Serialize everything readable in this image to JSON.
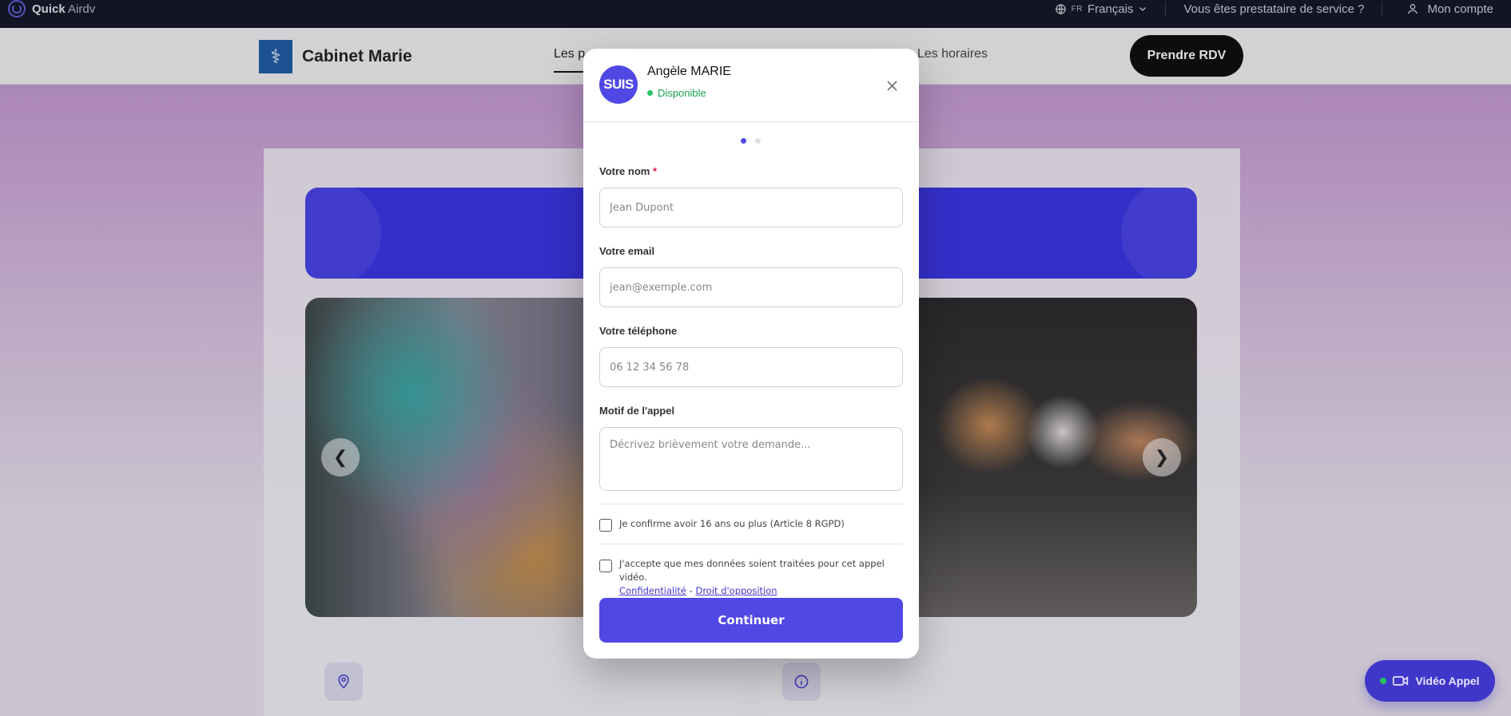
{
  "topbar": {
    "brand_bold": "Quick",
    "brand_rest": "Airdv",
    "lang_code": "FR",
    "lang_label": "Français",
    "provider_link": "Vous êtes prestataire de service ?",
    "account_label": "Mon compte"
  },
  "header": {
    "title": "Cabinet Marie",
    "nav_active": "Les p",
    "nav_hours": "Les horaires",
    "cta": "Prendre RDV"
  },
  "modal": {
    "avatar_text": "SUIS",
    "name": "Angèle MARIE",
    "status": "Disponible",
    "steps_total": 2,
    "steps_current": 1,
    "fields": {
      "name_label": "Votre nom",
      "name_required_mark": "*",
      "name_placeholder": "Jean Dupont",
      "email_label": "Votre email",
      "email_placeholder": "jean@exemple.com",
      "phone_label": "Votre téléphone",
      "phone_placeholder": "06 12 34 56 78",
      "reason_label": "Motif de l'appel",
      "reason_placeholder": "Décrivez brièvement votre demande..."
    },
    "consent_age": "Je confirme avoir 16 ans ou plus (Article 8 RGPD)",
    "consent_data": "J'accepte que mes données soient traitées pour cet appel vidéo.",
    "privacy_link": "Confidentialité",
    "link_separator": "-",
    "opposition_link": "Droit d'opposition",
    "submit": "Continuer"
  },
  "video_call": {
    "label": "Vidéo Appel"
  },
  "colors": {
    "accent": "#5048e5",
    "topbar_bg": "#141726",
    "status_green": "#22c55e"
  }
}
